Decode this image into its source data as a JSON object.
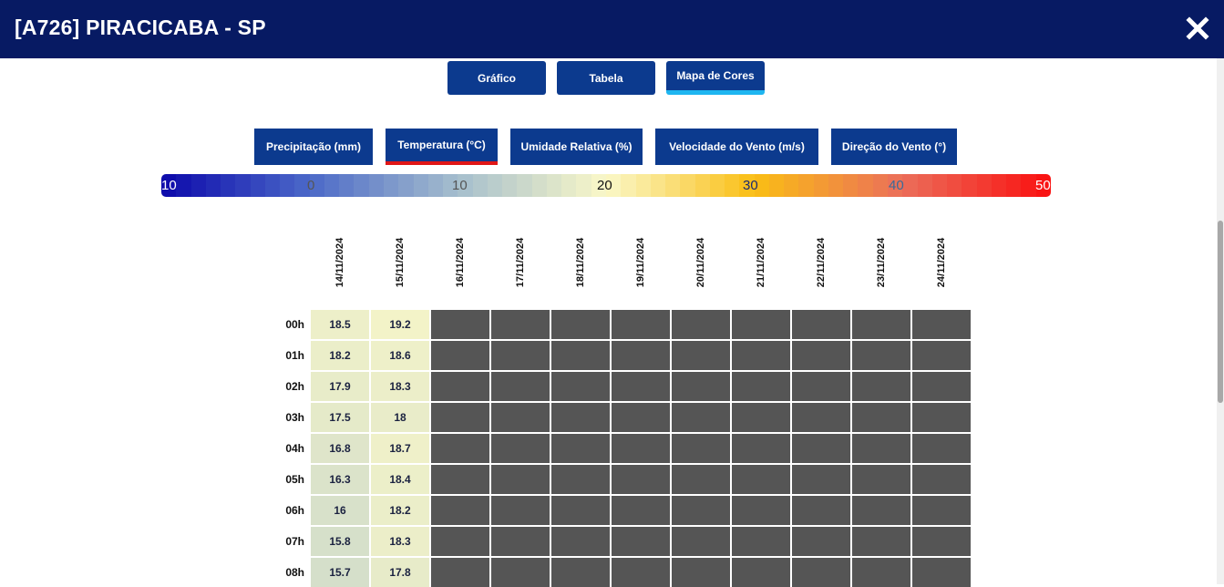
{
  "header": {
    "title": "[A726] PIRACICABA - SP",
    "close_icon": "close-icon"
  },
  "view_buttons": [
    {
      "label": "Gráfico",
      "active": false
    },
    {
      "label": "Tabela",
      "active": false
    },
    {
      "label": "Mapa de Cores",
      "active": true
    }
  ],
  "variable_tabs": [
    {
      "label": "Precipitação (mm)",
      "active": false
    },
    {
      "label": "Temperatura (°C)",
      "active": true
    },
    {
      "label": "Umidade Relativa (%)",
      "active": false
    },
    {
      "label": "Velocidade do Vento (m/s)",
      "active": false
    },
    {
      "label": "Direção do Vento (°)",
      "active": false
    }
  ],
  "color_scale": {
    "labels": [
      "10",
      "0",
      "10",
      "20",
      "30",
      "40",
      "50"
    ],
    "min": -10,
    "max": 50
  },
  "dates": [
    "14/11/2024",
    "15/11/2024",
    "16/11/2024",
    "17/11/2024",
    "18/11/2024",
    "19/11/2024",
    "20/11/2024",
    "21/11/2024",
    "22/11/2024",
    "23/11/2024",
    "24/11/2024"
  ],
  "hours": [
    "00h",
    "01h",
    "02h",
    "03h",
    "04h",
    "05h",
    "06h",
    "07h",
    "08h"
  ],
  "values": [
    [
      "18.5",
      "19.2"
    ],
    [
      "18.2",
      "18.6"
    ],
    [
      "17.9",
      "18.3"
    ],
    [
      "17.5",
      "18"
    ],
    [
      "16.8",
      "18.7"
    ],
    [
      "16.3",
      "18.4"
    ],
    [
      "16",
      "18.2"
    ],
    [
      "15.8",
      "18.3"
    ],
    [
      "15.7",
      "17.8"
    ]
  ],
  "colors": {
    "header": "#071a63",
    "button": "#0c3a8e",
    "active_view_underline": "#1fb6f0",
    "active_tab_underline": "#e01616",
    "no_data": "#555555"
  }
}
